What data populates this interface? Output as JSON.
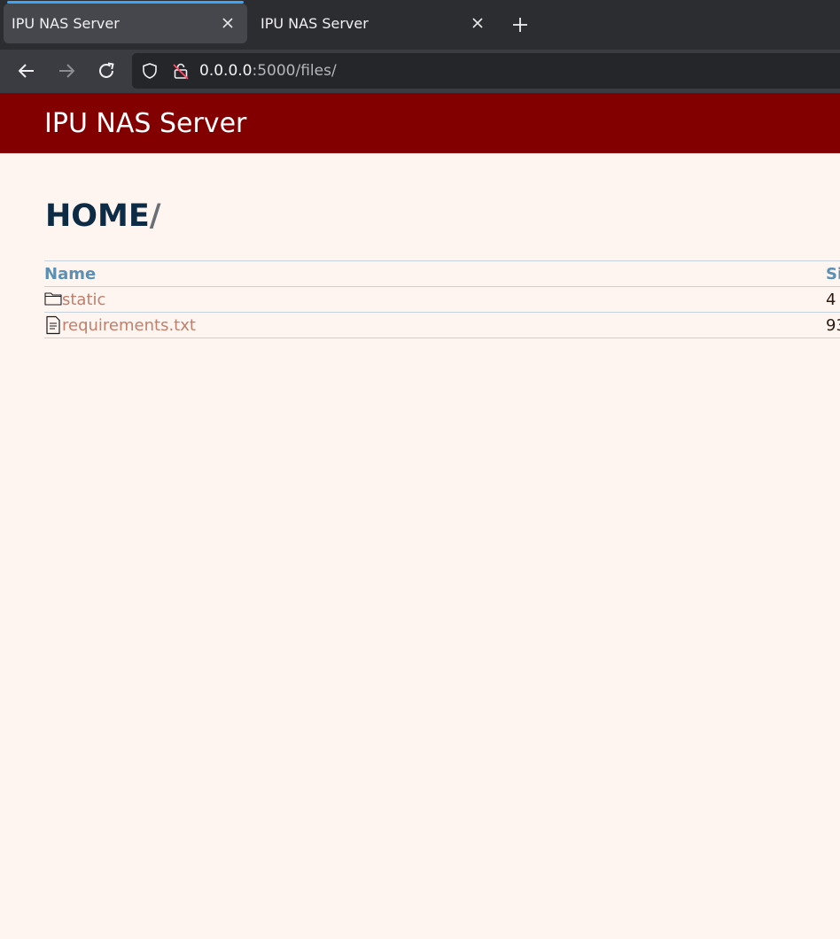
{
  "browser": {
    "tabs": [
      {
        "title": "IPU NAS Server",
        "active": true
      },
      {
        "title": "IPU NAS Server",
        "active": false
      }
    ],
    "url": {
      "host": "0.0.0.0",
      "rest": ":5000/files/"
    },
    "accent": "#3da5f5"
  },
  "header": {
    "title": "IPU NAS Server",
    "background": "#820000"
  },
  "breadcrumb": {
    "home": "HOME",
    "separator": "/"
  },
  "table": {
    "columns": {
      "name": "Name",
      "size": "Si"
    },
    "rows": [
      {
        "name": "static",
        "size": "4",
        "icon": "folder-icon"
      },
      {
        "name": "requirements.txt",
        "size": "93",
        "icon": "file-text-icon"
      }
    ]
  }
}
